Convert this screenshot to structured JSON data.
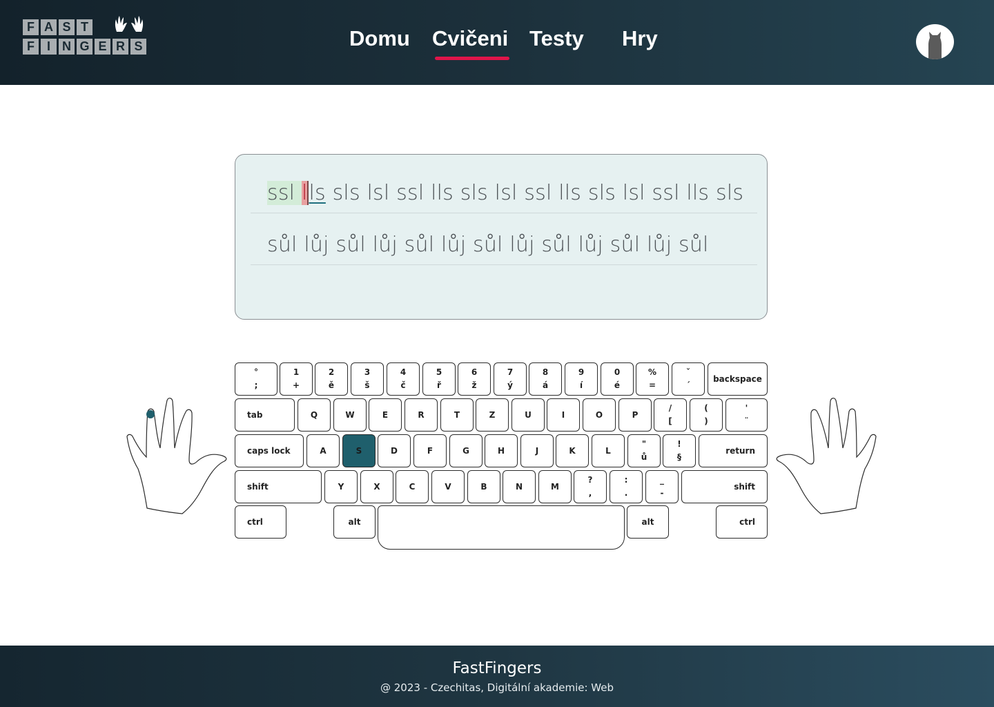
{
  "header": {
    "logo": {
      "row1": [
        "F",
        "A",
        "S",
        "T"
      ],
      "row2": [
        "F",
        "I",
        "N",
        "G",
        "E",
        "R",
        "S"
      ],
      "hands_icon": "waving-hands-icon"
    },
    "nav": [
      {
        "label": "Domu",
        "active": false
      },
      {
        "label": "Cvičeni",
        "active": true
      },
      {
        "label": "Testy",
        "active": false
      },
      {
        "label": "Hry",
        "active": false
      }
    ],
    "avatar_icon": "cat-avatar-icon",
    "accent_color": "#e0154a"
  },
  "exercise": {
    "line1": {
      "typed": "ssl ",
      "error": "l",
      "current": "ls",
      "rest": " sls lsl ssl lls sls lsl ssl lls sls lsl ssl lls sls"
    },
    "line2": "sůl lůj sůl lůj sůl lůj sůl lůj sůl lůj sůl lůj sůl"
  },
  "keyboard": {
    "active_key": "S",
    "active_color": "#1f5f6c",
    "row1": [
      {
        "top": "°",
        "bot": ";"
      },
      {
        "top": "1",
        "bot": "+"
      },
      {
        "top": "2",
        "bot": "ě"
      },
      {
        "top": "3",
        "bot": "š"
      },
      {
        "top": "4",
        "bot": "č"
      },
      {
        "top": "5",
        "bot": "ř"
      },
      {
        "top": "6",
        "bot": "ž"
      },
      {
        "top": "7",
        "bot": "ý"
      },
      {
        "top": "8",
        "bot": "á"
      },
      {
        "top": "9",
        "bot": "í"
      },
      {
        "top": "0",
        "bot": "é"
      },
      {
        "top": "%",
        "bot": "="
      },
      {
        "top": "ˇ",
        "bot": "´"
      }
    ],
    "backspace": "backspace",
    "tab": "tab",
    "row2": [
      "Q",
      "W",
      "E",
      "R",
      "T",
      "Z",
      "U",
      "I",
      "O",
      "P"
    ],
    "row2_extra": [
      {
        "top": "/",
        "bot": "["
      },
      {
        "top": "(",
        "bot": ")"
      },
      {
        "top": "'",
        "bot": "¨"
      }
    ],
    "caps": "caps lock",
    "row3": [
      "A",
      "S",
      "D",
      "F",
      "G",
      "H",
      "J",
      "K",
      "L"
    ],
    "row3_extra": [
      {
        "top": "\"",
        "bot": "ů"
      },
      {
        "top": "!",
        "bot": "§"
      }
    ],
    "return": "return",
    "shift_left": "shift",
    "row4": [
      "Y",
      "X",
      "C",
      "V",
      "B",
      "N",
      "M"
    ],
    "row4_extra": [
      {
        "top": "?",
        "bot": ","
      },
      {
        "top": ":",
        "bot": "."
      },
      {
        "top": "_",
        "bot": "-"
      }
    ],
    "shift_right": "shift",
    "ctrl_left": "ctrl",
    "alt_left": "alt",
    "alt_right": "alt",
    "ctrl_right": "ctrl",
    "finger_marker_color": "#1f5f6c"
  },
  "footer": {
    "title": "FastFingers",
    "subtitle": "@ 2023 - Czechitas, Digitální akademie: Web"
  }
}
